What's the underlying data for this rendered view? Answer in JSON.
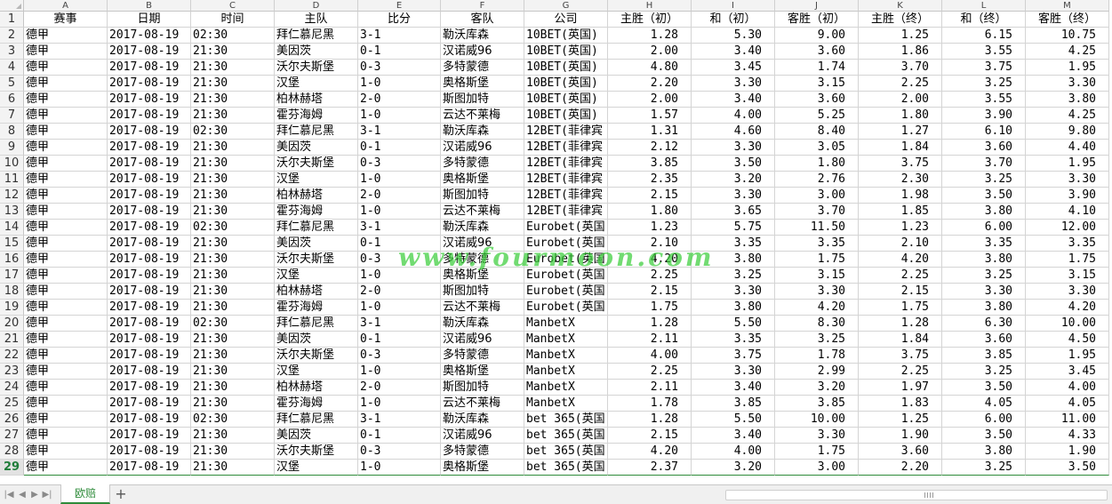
{
  "spreadsheet": {
    "column_letters": [
      "A",
      "B",
      "C",
      "D",
      "E",
      "F",
      "G",
      "H",
      "I",
      "J",
      "K",
      "L",
      "M"
    ],
    "header_row": [
      "赛事",
      "日期",
      "时间",
      "主队",
      "比分",
      "客队",
      "公司",
      "主胜（初）",
      "和（初）",
      "客胜（初）",
      "主胜（终）",
      "和（终）",
      "客胜（终）"
    ],
    "row_numbers": [
      "1",
      "2",
      "3",
      "4",
      "5",
      "6",
      "7",
      "8",
      "9",
      "10",
      "11",
      "12",
      "13",
      "14",
      "15",
      "16",
      "17",
      "18",
      "19",
      "20",
      "21",
      "22",
      "23",
      "24",
      "25",
      "26",
      "27",
      "28",
      "29"
    ],
    "active_row": "29",
    "rows": [
      [
        "德甲",
        "2017-08-19",
        "02:30",
        "拜仁慕尼黑",
        "3-1",
        "勒沃库森",
        "10BET(英国)",
        "1.28",
        "5.30",
        "9.00",
        "1.25",
        "6.15",
        "10.75"
      ],
      [
        "德甲",
        "2017-08-19",
        "21:30",
        "美因茨",
        "0-1",
        "汉诺威96",
        "10BET(英国)",
        "2.00",
        "3.40",
        "3.60",
        "1.86",
        "3.55",
        "4.25"
      ],
      [
        "德甲",
        "2017-08-19",
        "21:30",
        "沃尔夫斯堡",
        "0-3",
        "多特蒙德",
        "10BET(英国)",
        "4.80",
        "3.45",
        "1.74",
        "3.70",
        "3.75",
        "1.95"
      ],
      [
        "德甲",
        "2017-08-19",
        "21:30",
        "汉堡",
        "1-0",
        "奥格斯堡",
        "10BET(英国)",
        "2.20",
        "3.30",
        "3.15",
        "2.25",
        "3.25",
        "3.30"
      ],
      [
        "德甲",
        "2017-08-19",
        "21:30",
        "柏林赫塔",
        "2-0",
        "斯图加特",
        "10BET(英国)",
        "2.00",
        "3.40",
        "3.60",
        "2.00",
        "3.55",
        "3.80"
      ],
      [
        "德甲",
        "2017-08-19",
        "21:30",
        "霍芬海姆",
        "1-0",
        "云达不莱梅",
        "10BET(英国)",
        "1.57",
        "4.00",
        "5.25",
        "1.80",
        "3.90",
        "4.25"
      ],
      [
        "德甲",
        "2017-08-19",
        "02:30",
        "拜仁慕尼黑",
        "3-1",
        "勒沃库森",
        "12BET(菲律宾",
        "1.31",
        "4.60",
        "8.40",
        "1.27",
        "6.10",
        "9.80"
      ],
      [
        "德甲",
        "2017-08-19",
        "21:30",
        "美因茨",
        "0-1",
        "汉诺威96",
        "12BET(菲律宾",
        "2.12",
        "3.30",
        "3.05",
        "1.84",
        "3.60",
        "4.40"
      ],
      [
        "德甲",
        "2017-08-19",
        "21:30",
        "沃尔夫斯堡",
        "0-3",
        "多特蒙德",
        "12BET(菲律宾",
        "3.85",
        "3.50",
        "1.80",
        "3.75",
        "3.70",
        "1.95"
      ],
      [
        "德甲",
        "2017-08-19",
        "21:30",
        "汉堡",
        "1-0",
        "奥格斯堡",
        "12BET(菲律宾",
        "2.35",
        "3.20",
        "2.76",
        "2.30",
        "3.25",
        "3.30"
      ],
      [
        "德甲",
        "2017-08-19",
        "21:30",
        "柏林赫塔",
        "2-0",
        "斯图加特",
        "12BET(菲律宾",
        "2.15",
        "3.30",
        "3.00",
        "1.98",
        "3.50",
        "3.90"
      ],
      [
        "德甲",
        "2017-08-19",
        "21:30",
        "霍芬海姆",
        "1-0",
        "云达不莱梅",
        "12BET(菲律宾",
        "1.80",
        "3.65",
        "3.70",
        "1.85",
        "3.80",
        "4.10"
      ],
      [
        "德甲",
        "2017-08-19",
        "02:30",
        "拜仁慕尼黑",
        "3-1",
        "勒沃库森",
        "Eurobet(英国",
        "1.23",
        "5.75",
        "11.50",
        "1.23",
        "6.00",
        "12.00"
      ],
      [
        "德甲",
        "2017-08-19",
        "21:30",
        "美因茨",
        "0-1",
        "汉诺威96",
        "Eurobet(英国",
        "2.10",
        "3.35",
        "3.35",
        "2.10",
        "3.35",
        "3.35"
      ],
      [
        "德甲",
        "2017-08-19",
        "21:30",
        "沃尔夫斯堡",
        "0-3",
        "多特蒙德",
        "Eurobet(英国",
        "4.20",
        "3.80",
        "1.75",
        "4.20",
        "3.80",
        "1.75"
      ],
      [
        "德甲",
        "2017-08-19",
        "21:30",
        "汉堡",
        "1-0",
        "奥格斯堡",
        "Eurobet(英国",
        "2.25",
        "3.25",
        "3.15",
        "2.25",
        "3.25",
        "3.15"
      ],
      [
        "德甲",
        "2017-08-19",
        "21:30",
        "柏林赫塔",
        "2-0",
        "斯图加特",
        "Eurobet(英国",
        "2.15",
        "3.30",
        "3.30",
        "2.15",
        "3.30",
        "3.30"
      ],
      [
        "德甲",
        "2017-08-19",
        "21:30",
        "霍芬海姆",
        "1-0",
        "云达不莱梅",
        "Eurobet(英国",
        "1.75",
        "3.80",
        "4.20",
        "1.75",
        "3.80",
        "4.20"
      ],
      [
        "德甲",
        "2017-08-19",
        "02:30",
        "拜仁慕尼黑",
        "3-1",
        "勒沃库森",
        "ManbetX",
        "1.28",
        "5.50",
        "8.30",
        "1.28",
        "6.30",
        "10.00"
      ],
      [
        "德甲",
        "2017-08-19",
        "21:30",
        "美因茨",
        "0-1",
        "汉诺威96",
        "ManbetX",
        "2.11",
        "3.35",
        "3.25",
        "1.84",
        "3.60",
        "4.50"
      ],
      [
        "德甲",
        "2017-08-19",
        "21:30",
        "沃尔夫斯堡",
        "0-3",
        "多特蒙德",
        "ManbetX",
        "4.00",
        "3.75",
        "1.78",
        "3.75",
        "3.85",
        "1.95"
      ],
      [
        "德甲",
        "2017-08-19",
        "21:30",
        "汉堡",
        "1-0",
        "奥格斯堡",
        "ManbetX",
        "2.25",
        "3.30",
        "2.99",
        "2.25",
        "3.25",
        "3.45"
      ],
      [
        "德甲",
        "2017-08-19",
        "21:30",
        "柏林赫塔",
        "2-0",
        "斯图加特",
        "ManbetX",
        "2.11",
        "3.40",
        "3.20",
        "1.97",
        "3.50",
        "4.00"
      ],
      [
        "德甲",
        "2017-08-19",
        "21:30",
        "霍芬海姆",
        "1-0",
        "云达不莱梅",
        "ManbetX",
        "1.78",
        "3.85",
        "3.85",
        "1.83",
        "4.05",
        "4.05"
      ],
      [
        "德甲",
        "2017-08-19",
        "02:30",
        "拜仁慕尼黑",
        "3-1",
        "勒沃库森",
        "bet 365(英国",
        "1.28",
        "5.50",
        "10.00",
        "1.25",
        "6.00",
        "11.00"
      ],
      [
        "德甲",
        "2017-08-19",
        "21:30",
        "美因茨",
        "0-1",
        "汉诺威96",
        "bet 365(英国",
        "2.15",
        "3.40",
        "3.30",
        "1.90",
        "3.50",
        "4.33"
      ],
      [
        "德甲",
        "2017-08-19",
        "21:30",
        "沃尔夫斯堡",
        "0-3",
        "多特蒙德",
        "bet 365(英国",
        "4.20",
        "4.00",
        "1.75",
        "3.60",
        "3.80",
        "1.90"
      ],
      [
        "德甲",
        "2017-08-19",
        "21:30",
        "汉堡",
        "1-0",
        "奥格斯堡",
        "bet 365(英国",
        "2.37",
        "3.20",
        "3.00",
        "2.20",
        "3.25",
        "3.50"
      ]
    ]
  },
  "watermark": "www.fourmoon.com",
  "statusbar": {
    "sheet_tab_label": "欧赔",
    "add_sheet_label": "+",
    "nav_icons": [
      "first-sheet-icon",
      "prev-sheet-icon",
      "next-sheet-icon",
      "last-sheet-icon"
    ]
  },
  "colors": {
    "accent_green": "#2e8b3a",
    "watermark_green": "#3ccd3c",
    "header_bg": "#f3f3f3",
    "gridline": "#d4d4d4"
  }
}
